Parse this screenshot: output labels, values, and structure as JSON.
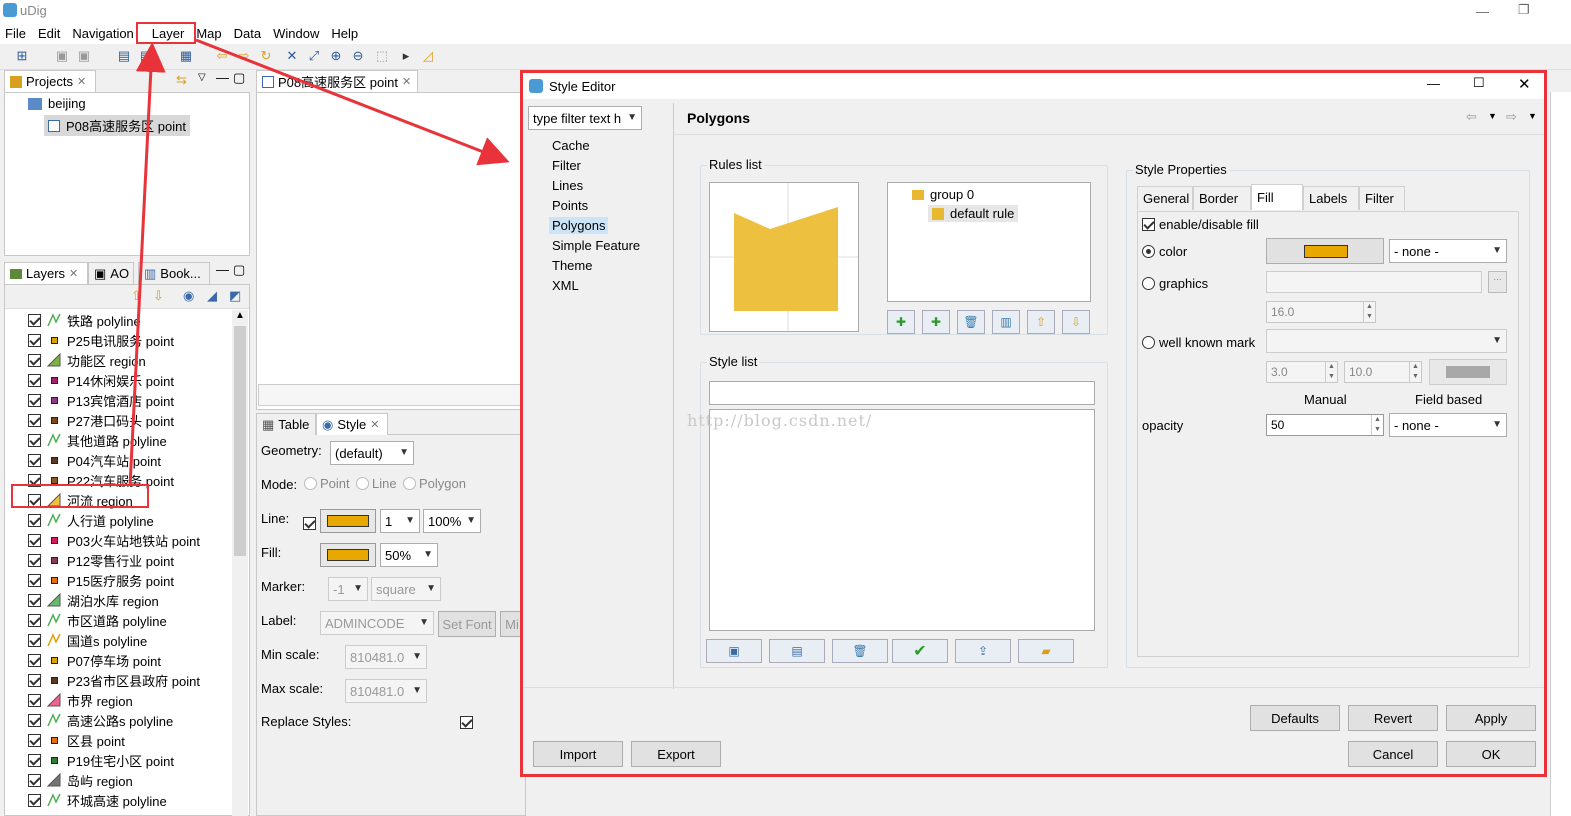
{
  "app": {
    "title": "uDig"
  },
  "menu": [
    "File",
    "Edit",
    "Navigation",
    "Layer",
    "Map",
    "Data",
    "Window",
    "Help"
  ],
  "projects_view": {
    "tab": "Projects",
    "project": "beijing",
    "map": "P08高速服务区 point"
  },
  "layers_view": {
    "tabs": [
      "Layers",
      "AO",
      "Book..."
    ],
    "layers": [
      {
        "name": "铁路 polyline",
        "kind": "polyline",
        "color": "#4caf50"
      },
      {
        "name": "P25电讯服务 point",
        "kind": "point",
        "color": "#e0a000"
      },
      {
        "name": "功能区 region",
        "kind": "region",
        "color": "#7cb342"
      },
      {
        "name": "P14休闲娱乐 point",
        "kind": "point",
        "color": "#a0226e"
      },
      {
        "name": "P13宾馆酒店 point",
        "kind": "point",
        "color": "#8d3a8a"
      },
      {
        "name": "P27港口码头 point",
        "kind": "point",
        "color": "#7a4a18"
      },
      {
        "name": "其他道路 polyline",
        "kind": "polyline",
        "color": "#4caf50"
      },
      {
        "name": "P04汽车站 point",
        "kind": "point",
        "color": "#5a3a22"
      },
      {
        "name": "P22汽车服务 point",
        "kind": "point",
        "color": "#8a5a20"
      },
      {
        "name": "河流 region",
        "kind": "region",
        "color": "#f2c040"
      },
      {
        "name": "人行道 polyline",
        "kind": "polyline",
        "color": "#4caf50"
      },
      {
        "name": "P03火车站地铁站 point",
        "kind": "point",
        "color": "#d81b60"
      },
      {
        "name": "P12零售行业 point",
        "kind": "point",
        "color": "#8a3a5a"
      },
      {
        "name": "P15医疗服务 point",
        "kind": "point",
        "color": "#e07010"
      },
      {
        "name": "湖泊水库 region",
        "kind": "region",
        "color": "#66bb6a"
      },
      {
        "name": "市区道路 polyline",
        "kind": "polyline",
        "color": "#4caf50"
      },
      {
        "name": "国道s polyline",
        "kind": "polyline",
        "color": "#e0a000"
      },
      {
        "name": "P07停车场 point",
        "kind": "point",
        "color": "#e0a000"
      },
      {
        "name": "P23省市区县政府 point",
        "kind": "point",
        "color": "#5a3a22"
      },
      {
        "name": "市界 region",
        "kind": "region",
        "color": "#f06292"
      },
      {
        "name": "高速公路s polyline",
        "kind": "polyline",
        "color": "#4caf50"
      },
      {
        "name": "区县 point",
        "kind": "point",
        "color": "#e07010"
      },
      {
        "name": "P19住宅小区 point",
        "kind": "point",
        "color": "#2e7d32"
      },
      {
        "name": "岛屿 region",
        "kind": "region",
        "color": "#757575"
      },
      {
        "name": "环城高速 polyline",
        "kind": "polyline",
        "color": "#4caf50"
      }
    ]
  },
  "map_editor": {
    "tab": "P08高速服务区 point"
  },
  "style_view": {
    "tabs": [
      "Table",
      "Style"
    ],
    "geometry_label": "Geometry:",
    "geometry_value": "(default)",
    "mode_label": "Mode:",
    "modes": [
      "Point",
      "Line",
      "Polygon"
    ],
    "line_label": "Line:",
    "line_width": "1",
    "line_opacity": "100%",
    "line_color": "#e8a800",
    "fill_label": "Fill:",
    "fill_opacity": "50%",
    "fill_color": "#e8a800",
    "marker_label": "Marker:",
    "marker_size": "-1",
    "marker_shape": "square",
    "label_label": "Label:",
    "label_value": "ADMINCODE",
    "set_font": "Set Font",
    "mi": "Mi",
    "min_scale_label": "Min scale:",
    "min_scale": "810481.0",
    "max_scale_label": "Max scale:",
    "max_scale": "810481.0",
    "replace_label": "Replace Styles:"
  },
  "dialog": {
    "title": "Style Editor",
    "filter_placeholder": "type filter text h",
    "pages": [
      "Cache",
      "Filter",
      "Lines",
      "Points",
      "Polygons",
      "Simple Feature",
      "Theme",
      "XML"
    ],
    "selected_page": "Polygons",
    "heading": "Polygons",
    "rules_list": "Rules list",
    "tree": {
      "group": "group 0",
      "rule": "default rule"
    },
    "style_list": "Style list",
    "watermark": "http://blog.csdn.net/",
    "style_props": "Style Properties",
    "tabs": [
      "General",
      "Border",
      "Fill",
      "Labels",
      "Filter"
    ],
    "enable_fill": "enable/disable fill",
    "color": "color",
    "fill_color": "#e8a800",
    "none1": "- none -",
    "graphics": "graphics",
    "graphics_size": "16.0",
    "wkm": "well known mark",
    "wkm_w": "3.0",
    "wkm_h": "10.0",
    "manual": "Manual",
    "field_based": "Field based",
    "opacity": "opacity",
    "opacity_value": "50",
    "none2": "- none -",
    "buttons": {
      "defaults": "Defaults",
      "revert": "Revert",
      "apply": "Apply",
      "import": "Import",
      "export": "Export",
      "cancel": "Cancel",
      "ok": "OK"
    },
    "preview_color": "#eec040"
  }
}
